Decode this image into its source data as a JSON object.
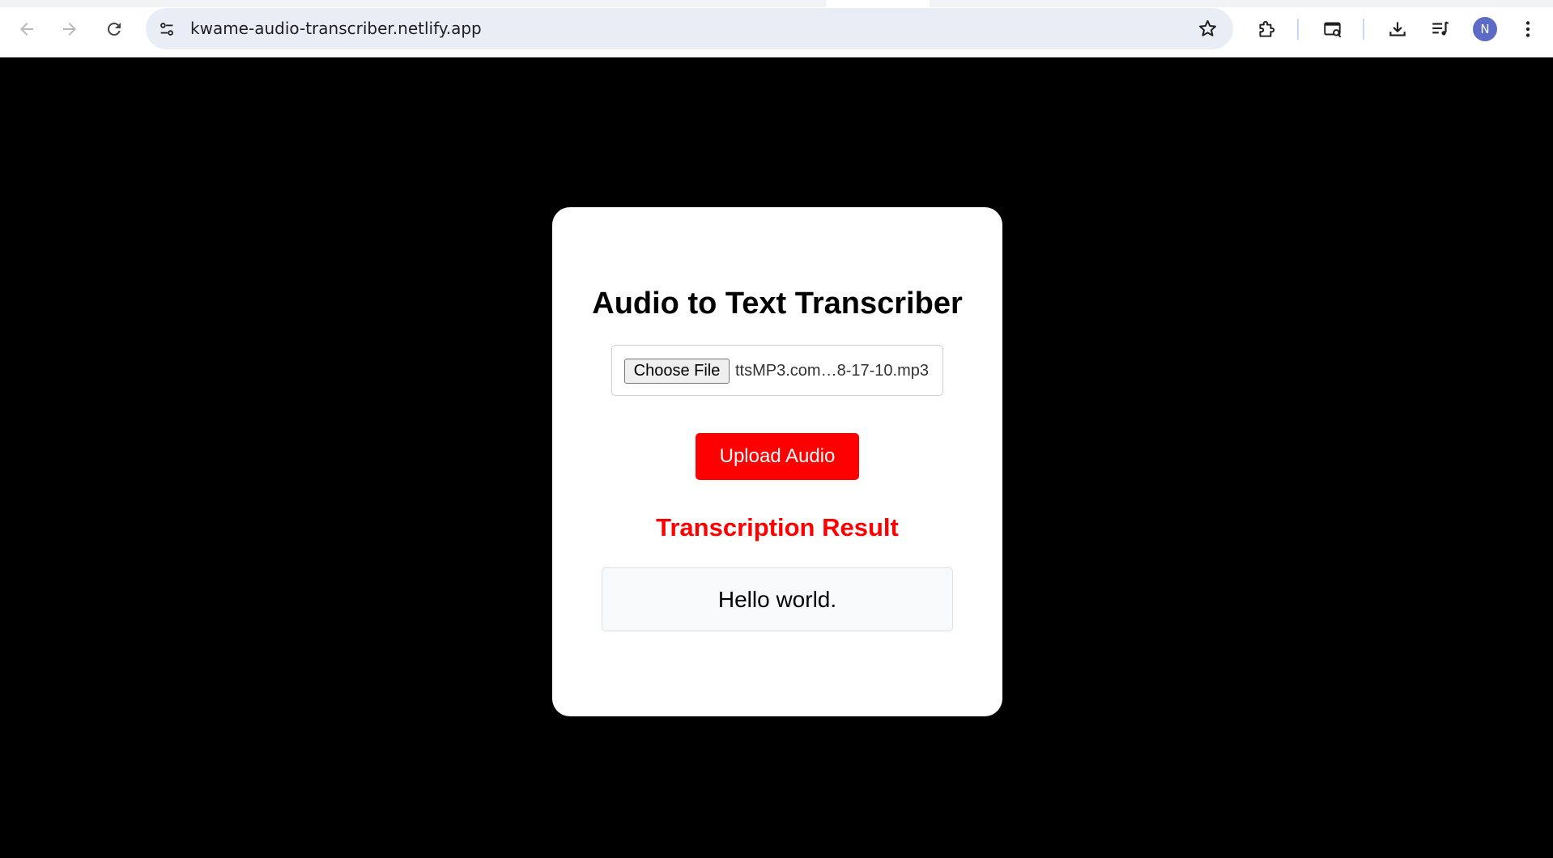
{
  "browser": {
    "url": "kwame-audio-transcriber.netlify.app",
    "profile_initial": "N",
    "icons": {
      "back": "arrow-left-icon",
      "forward": "arrow-right-icon",
      "reload": "reload-icon",
      "site_info": "tune-icon",
      "bookmark": "star-icon",
      "extensions": "puzzle-icon",
      "cast": "search-tabs-icon",
      "downloads": "download-icon",
      "media": "media-queue-icon",
      "menu": "kebab-menu-icon"
    }
  },
  "app": {
    "title": "Audio to Text Transcriber",
    "file_input": {
      "button_label": "Choose File",
      "file_name": "ttsMP3.com…8-17-10.mp3"
    },
    "upload_button_label": "Upload Audio",
    "result_heading": "Transcription Result",
    "result_text": "Hello world."
  },
  "colors": {
    "accent": "#ff0000",
    "page_background": "#000000",
    "card_background": "#ffffff",
    "avatar": "#5b6bc6"
  }
}
